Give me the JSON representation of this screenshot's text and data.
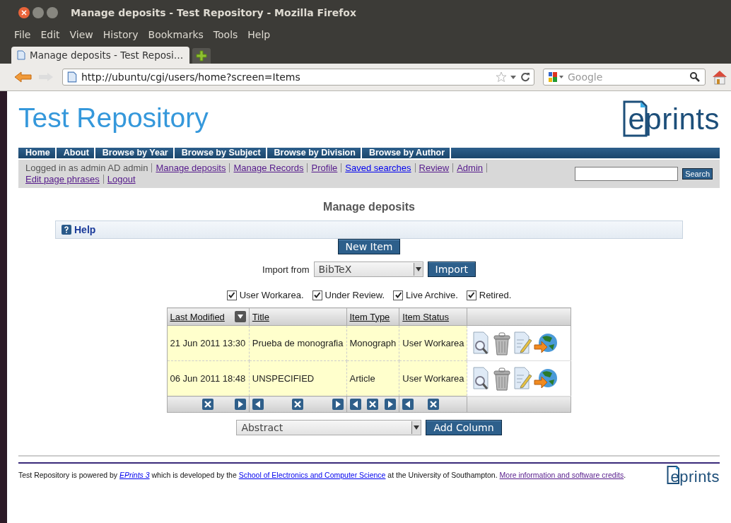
{
  "window": {
    "title": "Manage deposits - Test Repository - Mozilla Firefox"
  },
  "menu": [
    "File",
    "Edit",
    "View",
    "History",
    "Bookmarks",
    "Tools",
    "Help"
  ],
  "tabs": [
    {
      "label": "Manage deposits - Test Reposi…",
      "selected": true
    }
  ],
  "address": {
    "value": "http://ubuntu/cgi/users/home?screen=Items"
  },
  "web_search": {
    "placeholder": "Google"
  },
  "site": {
    "title": "Test Repository",
    "logo": "eprints"
  },
  "nav": [
    "Home",
    "About",
    "Browse by Year",
    "Browse by Subject",
    "Browse by Division",
    "Browse by Author"
  ],
  "user_bar": {
    "logged_in": "Logged in as admin AD admin",
    "links": [
      {
        "label": "Manage deposits",
        "visited": true
      },
      {
        "label": "Manage Records",
        "visited": true
      },
      {
        "label": "Profile",
        "visited": true
      },
      {
        "label": "Saved searches",
        "visited": false
      },
      {
        "label": "Review",
        "visited": true
      },
      {
        "label": "Admin",
        "visited": true
      },
      {
        "label": "Edit page phrases",
        "visited": true
      },
      {
        "label": "Logout",
        "visited": true
      }
    ],
    "search_button": "Search"
  },
  "page_title": "Manage deposits",
  "help": "Help",
  "new_item": "New Item",
  "import": {
    "label": "Import from",
    "value": "BibTeX",
    "button": "Import"
  },
  "filters": [
    {
      "label": "User Workarea.",
      "checked": true
    },
    {
      "label": "Under Review.",
      "checked": true
    },
    {
      "label": "Live Archive.",
      "checked": true
    },
    {
      "label": "Retired.",
      "checked": true
    }
  ],
  "table": {
    "columns": [
      {
        "label": "Last Modified",
        "sorted": true,
        "can_move_left": false,
        "can_move_right": true
      },
      {
        "label": "Title",
        "sorted": false,
        "can_move_left": true,
        "can_move_right": true
      },
      {
        "label": "Item Type",
        "sorted": false,
        "can_move_left": true,
        "can_move_right": true
      },
      {
        "label": "Item Status",
        "sorted": false,
        "can_move_left": true,
        "can_move_right": false
      }
    ],
    "rows": [
      [
        "21 Jun 2011 13:30",
        "Prueba de monografia",
        "Monograph",
        "User Workarea"
      ],
      [
        "06 Jun 2011 18:48",
        "UNSPECIFIED",
        "Article",
        "User Workarea"
      ]
    ]
  },
  "add_column": {
    "value": "Abstract",
    "button": "Add Column"
  },
  "footer": {
    "parts": [
      {
        "kind": "text",
        "text": "Test Repository is powered by "
      },
      {
        "kind": "ilink",
        "text": "EPrints 3"
      },
      {
        "kind": "text",
        "text": " which is developed by the "
      },
      {
        "kind": "link",
        "text": "School of Electronics and Computer Science"
      },
      {
        "kind": "text",
        "text": " at the University of Southampton. "
      },
      {
        "kind": "vlink",
        "text": "More information and software credits"
      },
      {
        "kind": "text",
        "text": "."
      }
    ],
    "logo": "eprints"
  }
}
